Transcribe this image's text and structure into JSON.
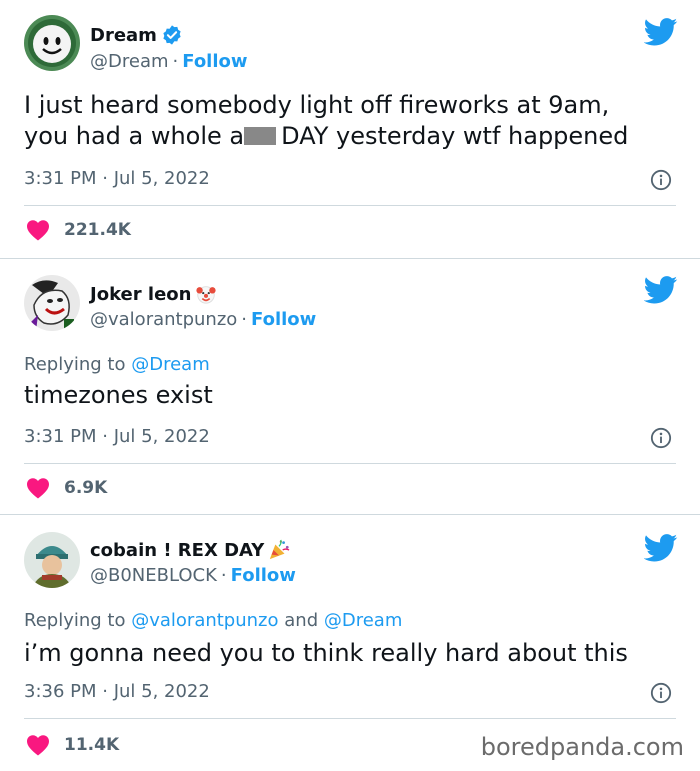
{
  "tweets": [
    {
      "display_name": "Dream",
      "handle": "@Dream",
      "follow_label": "Follow",
      "verified": true,
      "lines": [
        "I just heard somebody light off fireworks at 9am,"
      ],
      "line2_pre": "you had a whole a",
      "line2_post": "DAY yesterday wtf happened",
      "time": "3:31 PM · Jul 5, 2022",
      "likes": "221.4K"
    },
    {
      "display_name": "Joker leon",
      "handle": "@valorantpunzo",
      "follow_label": "Follow",
      "reply_prefix": "Replying to",
      "reply_mentions": "@Dream",
      "text": "timezones exist",
      "time": "3:31 PM · Jul 5, 2022",
      "likes": "6.9K"
    },
    {
      "display_name": "cobain ! REX DAY",
      "handle": "@B0NEBLOCK",
      "follow_label": "Follow",
      "reply_prefix": "Replying to",
      "reply_mention_1": "@valorantpunzo",
      "reply_and": "and",
      "reply_mention_2": "@Dream",
      "text": "i’m gonna need you to think really hard about this",
      "time": "3:36 PM · Jul 5, 2022",
      "likes": "11.4K"
    }
  ],
  "watermark": "boredpanda.com",
  "colors": {
    "twitter_blue": "#1d9bf0",
    "heart": "#f91880",
    "muted": "#536471",
    "divider": "#cfd9de"
  },
  "icons": [
    "verified-badge-icon",
    "twitter-bird-icon",
    "info-icon",
    "heart-icon",
    "clown-emoji-icon",
    "party-popper-emoji-icon"
  ]
}
